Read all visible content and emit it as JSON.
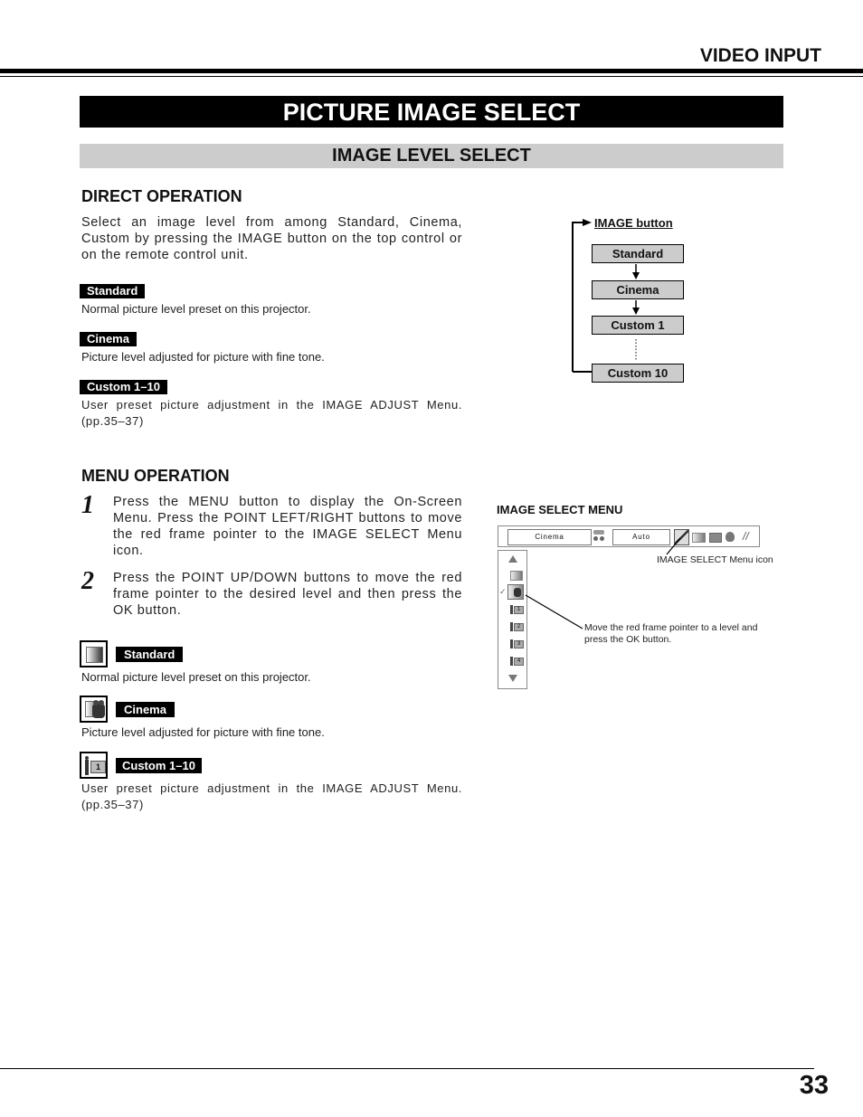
{
  "header": {
    "section": "VIDEO INPUT",
    "title": "PICTURE IMAGE SELECT",
    "subtitle": "IMAGE LEVEL SELECT"
  },
  "direct_operation": {
    "heading": "DIRECT OPERATION",
    "intro": "Select an image level from among Standard, Cinema, Custom by pressing the IMAGE button on the top control or on the remote control unit.",
    "items": [
      {
        "tag": "Standard",
        "desc": "Normal picture level preset on this projector."
      },
      {
        "tag": "Cinema",
        "desc": "Picture level adjusted for picture with fine tone."
      },
      {
        "tag": "Custom 1–10",
        "desc": "User preset picture adjustment in the IMAGE ADJUST Menu. (pp.35–37)"
      }
    ],
    "flow": {
      "button_label": "IMAGE button",
      "boxes": [
        "Standard",
        "Cinema",
        "Custom 1",
        "Custom 10"
      ]
    }
  },
  "menu_operation": {
    "heading": "MENU OPERATION",
    "steps": [
      {
        "num": "1",
        "text": "Press the MENU button to display the On-Screen Menu. Press the POINT LEFT/RIGHT buttons to move the red frame pointer to the IMAGE SELECT Menu icon."
      },
      {
        "num": "2",
        "text": "Press the POINT UP/DOWN buttons to move the red frame pointer to the desired level and then press the OK button."
      }
    ],
    "items": [
      {
        "tag": "Standard",
        "icon": "standard-gradient-icon",
        "desc": "Normal picture level preset on this projector."
      },
      {
        "tag": "Cinema",
        "icon": "cinema-projector-icon",
        "desc": "Picture level adjusted for picture with fine tone."
      },
      {
        "tag": "Custom 1–10",
        "icon": "custom-person-icon",
        "desc": "User preset picture adjustment in the IMAGE ADJUST Menu. (pp.35–37)"
      }
    ]
  },
  "menu_figure": {
    "heading": "IMAGE SELECT MENU",
    "toolbar": {
      "current_level": "Cinema",
      "mode_value": "Auto"
    },
    "callout_icon": "IMAGE SELECT Menu icon",
    "callout_pointer": "Move the red frame pointer to a level and press the OK button.",
    "list_items": [
      "Standard",
      "Cinema",
      "Custom 1",
      "Custom 2",
      "Custom 3",
      "Custom 4"
    ],
    "list_numbers": [
      "1",
      "2",
      "3",
      "4"
    ],
    "selected_item": "Cinema"
  },
  "footer": {
    "page_number": "33"
  }
}
